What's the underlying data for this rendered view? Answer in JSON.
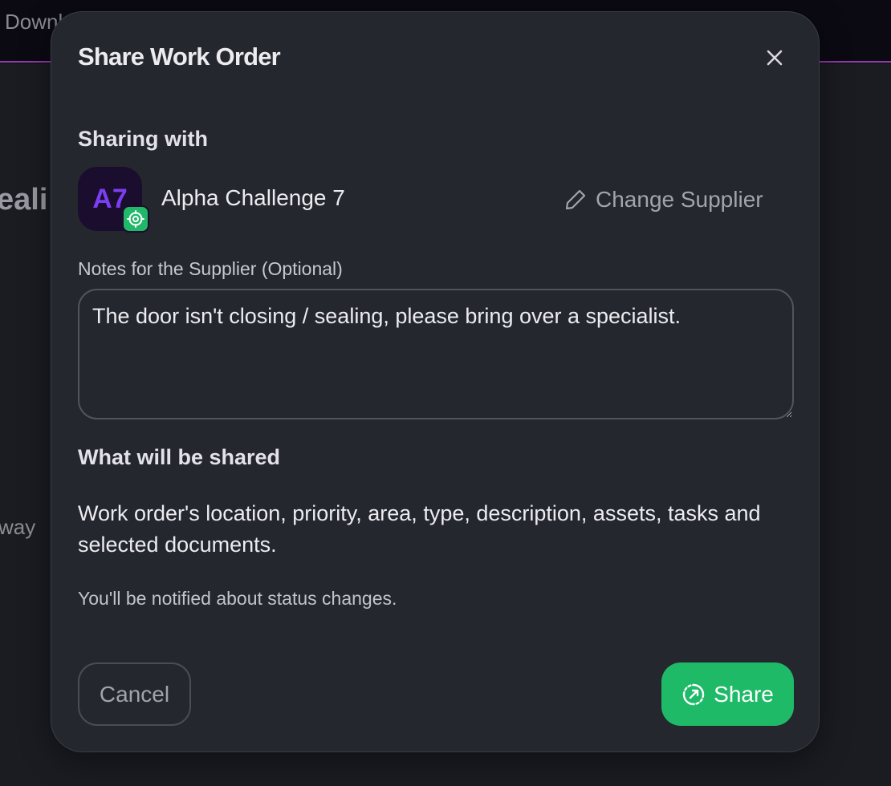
{
  "background": {
    "topbar_text": "Downl",
    "heading_fragment": "eali",
    "text_fragment": "way"
  },
  "modal": {
    "title": "Share Work Order",
    "close_icon": "close-icon",
    "sharing_with_label": "Sharing with",
    "supplier": {
      "initials": "A7",
      "name": "Alpha Challenge 7",
      "badge_icon": "verified-network-icon",
      "avatar_color": "#7a3ff0"
    },
    "change_supplier": {
      "icon": "pencil-icon",
      "label": "Change Supplier"
    },
    "notes": {
      "label": "Notes for the Supplier (Optional)",
      "value": "The door isn't closing / sealing, please bring over a specialist."
    },
    "what_shared_label": "What will be shared",
    "what_shared_description": "Work order's location, priority, area, type, description, assets, tasks and selected documents.",
    "notify_text": "You'll be notified about status changes.",
    "buttons": {
      "cancel_label": "Cancel",
      "share_label": "Share",
      "share_icon": "share-icon"
    }
  },
  "colors": {
    "accent_green": "#1fba68",
    "modal_bg": "#25272f",
    "topbar_border": "#8f3aa6"
  }
}
